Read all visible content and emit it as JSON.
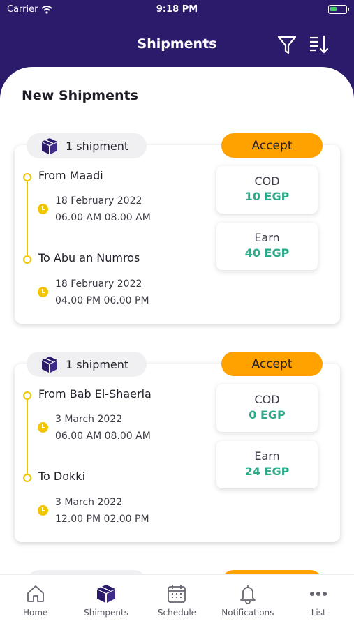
{
  "status_bar": {
    "carrier": "Carrier",
    "time": "9:18 PM"
  },
  "header": {
    "title": "Shipments"
  },
  "section_title": "New Shipments",
  "colors": {
    "brand": "#2c1a6b",
    "accent": "#ffa200",
    "route": "#f2c500",
    "money": "#2eaa8a"
  },
  "shipments": [
    {
      "count_label": "1 shipment",
      "accept_label": "Accept",
      "from": "From Maadi",
      "from_date": "18 February 2022",
      "from_time": "06.00 AM 08.00 AM",
      "to": "To Abu an Numros",
      "to_date": "18 February 2022",
      "to_time": "04.00 PM 06.00 PM",
      "cod_label": "COD",
      "cod_value": "10 EGP",
      "earn_label": "Earn",
      "earn_value": "40 EGP"
    },
    {
      "count_label": "1 shipment",
      "accept_label": "Accept",
      "from": "From Bab El-Shaeria",
      "from_date": "3 March 2022",
      "from_time": "06.00 AM 08.00 AM",
      "to": "To Dokki",
      "to_date": "3 March 2022",
      "to_time": "12.00 PM 02.00 PM",
      "cod_label": "COD",
      "cod_value": "0 EGP",
      "earn_label": "Earn",
      "earn_value": "24 EGP"
    }
  ],
  "tabs": [
    {
      "label": "Home",
      "icon": "home-icon"
    },
    {
      "label": "Shimpents",
      "icon": "box-icon"
    },
    {
      "label": "Schedule",
      "icon": "calendar-icon"
    },
    {
      "label": "Notifications",
      "icon": "bell-icon"
    },
    {
      "label": "List",
      "icon": "more-icon"
    }
  ]
}
